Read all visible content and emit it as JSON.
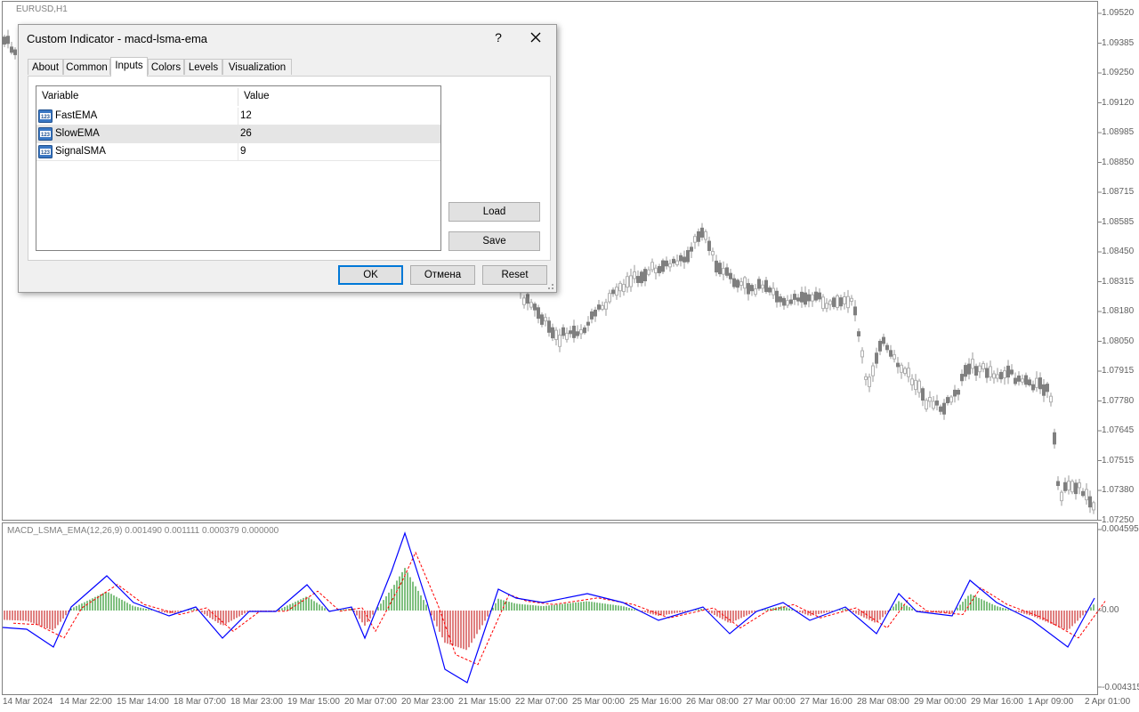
{
  "chart": {
    "symbol": "EURUSD,H1",
    "price_labels": [
      "1.09520",
      "1.09385",
      "1.09250",
      "1.09120",
      "1.08985",
      "1.08850",
      "1.08715",
      "1.08585",
      "1.08450",
      "1.08315",
      "1.08180",
      "1.08050",
      "1.07915",
      "1.07780",
      "1.07645",
      "1.07515",
      "1.07380",
      "1.07250"
    ],
    "indicator_label": "MACD_LSMA_EMA(12,26,9) 0.001490 0.001111 0.000379 0.000000",
    "indicator_scale": [
      "0.004595",
      "0.00",
      "-0.004315"
    ],
    "time_labels": [
      "14 Mar 2024",
      "14 Mar 22:00",
      "15 Mar 14:00",
      "18 Mar 07:00",
      "18 Mar 23:00",
      "19 Mar 15:00",
      "20 Mar 07:00",
      "20 Mar 23:00",
      "21 Mar 15:00",
      "22 Mar 07:00",
      "25 Mar 00:00",
      "25 Mar 16:00",
      "26 Mar 08:00",
      "27 Mar 00:00",
      "27 Mar 16:00",
      "28 Mar 08:00",
      "29 Mar 00:00",
      "29 Mar 16:00",
      "1 Apr 09:00",
      "2 Apr 01:00"
    ],
    "colors": {
      "candle": "#7f7f7f",
      "macd_line": "#0000ff",
      "signal_line": "#ff0000",
      "hist_pos": "#008000",
      "hist_neg": "#c00000"
    }
  },
  "dialog": {
    "title": "Custom Indicator - macd-lsma-ema",
    "help_label": "?",
    "close_icon": "close-icon",
    "tabs": [
      "About",
      "Common",
      "Inputs",
      "Colors",
      "Levels",
      "Visualization"
    ],
    "active_tab": "Inputs",
    "table": {
      "headers": [
        "Variable",
        "Value"
      ],
      "rows": [
        {
          "variable": "FastEMA",
          "value": "12",
          "icon": "integer-123-icon"
        },
        {
          "variable": "SlowEMA",
          "value": "26",
          "icon": "integer-123-icon"
        },
        {
          "variable": "SignalSMA",
          "value": "9",
          "icon": "integer-123-icon"
        }
      ],
      "selected_row": 1
    },
    "buttons": {
      "load": "Load",
      "save": "Save",
      "ok": "OK",
      "cancel": "Отмена",
      "reset": "Reset"
    }
  }
}
